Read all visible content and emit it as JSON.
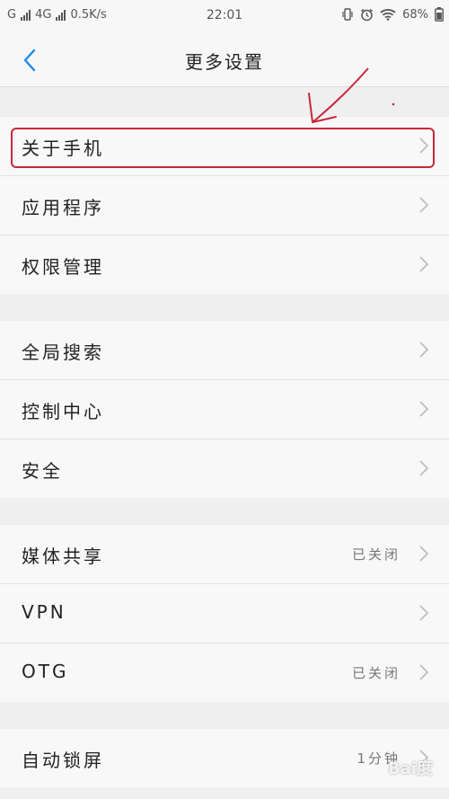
{
  "status": {
    "carrier1": "G",
    "carrier2": "4G",
    "speed": "0.5K/s",
    "time": "22:01",
    "battery": "68%",
    "icons": [
      "signal-icon",
      "vibrate-icon",
      "alarm-icon",
      "wifi-icon",
      "battery-icon"
    ]
  },
  "header": {
    "title": "更多设置",
    "back_icon": "chevron-left-icon"
  },
  "groups": [
    {
      "items": [
        {
          "label": "关于手机"
        },
        {
          "label": "应用程序"
        },
        {
          "label": "权限管理"
        }
      ]
    },
    {
      "items": [
        {
          "label": "全局搜索"
        },
        {
          "label": "控制中心"
        },
        {
          "label": "安全"
        }
      ]
    },
    {
      "items": [
        {
          "label": "媒体共享",
          "value": "已关闭"
        },
        {
          "label": "VPN"
        },
        {
          "label": "OTG",
          "value": "已关闭"
        }
      ]
    },
    {
      "items": [
        {
          "label": "自动锁屏",
          "value": "1分钟"
        }
      ]
    }
  ],
  "colors": {
    "accent": "#1e88e5",
    "highlight": "#c7283a"
  },
  "watermark": "Bai度"
}
